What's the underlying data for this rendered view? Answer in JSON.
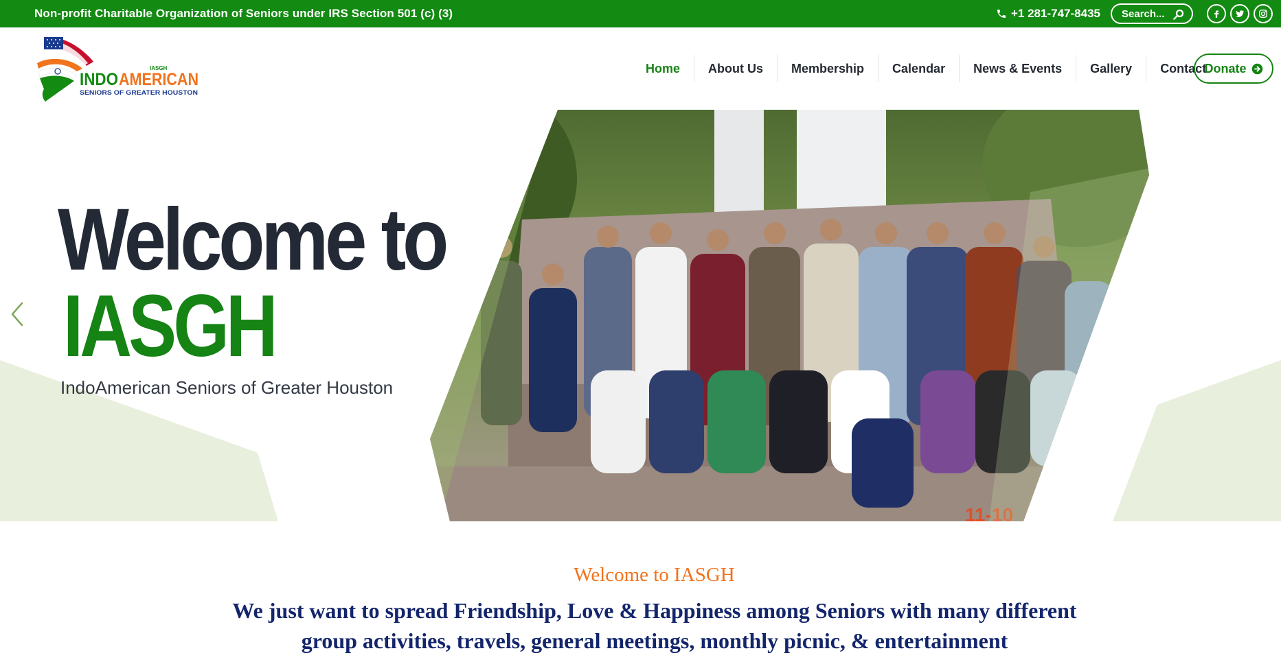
{
  "topbar": {
    "tagline": "Non-profit Charitable Organization of Seniors under IRS Section 501 (c) (3)",
    "phone": "+1 281-747-8435",
    "search_placeholder": "Search...",
    "bg_color": "#138a12",
    "social": [
      "facebook-icon",
      "twitter-icon",
      "instagram-icon"
    ]
  },
  "logo": {
    "small_text": "IASGH",
    "brand_part1": "INDO",
    "brand_part2": "AMERICAN",
    "subtitle": "SENIORS OF GREATER HOUSTON"
  },
  "nav": {
    "items": [
      {
        "label": "Home",
        "active": true
      },
      {
        "label": "About Us"
      },
      {
        "label": "Membership"
      },
      {
        "label": "Calendar"
      },
      {
        "label": "News & Events"
      },
      {
        "label": "Gallery"
      },
      {
        "label": "Contact"
      }
    ],
    "donate_label": "Donate",
    "accent": "#168315"
  },
  "hero": {
    "title_line1": "Welcome to",
    "title_line2": "IASGH",
    "subtitle": "IndoAmerican Seniors of Greater Houston",
    "photo_text": "11-10"
  },
  "welcome": {
    "heading": "Welcome to IASGH",
    "text": "We just want to spread Friendship, Love & Happiness among Seniors with many different group activities, travels, general meetings, monthly picnic, & entertainment"
  },
  "colors": {
    "green": "#168315",
    "orange": "#f0731d",
    "navy": "#13256b",
    "light_green": "#e8efdc"
  }
}
